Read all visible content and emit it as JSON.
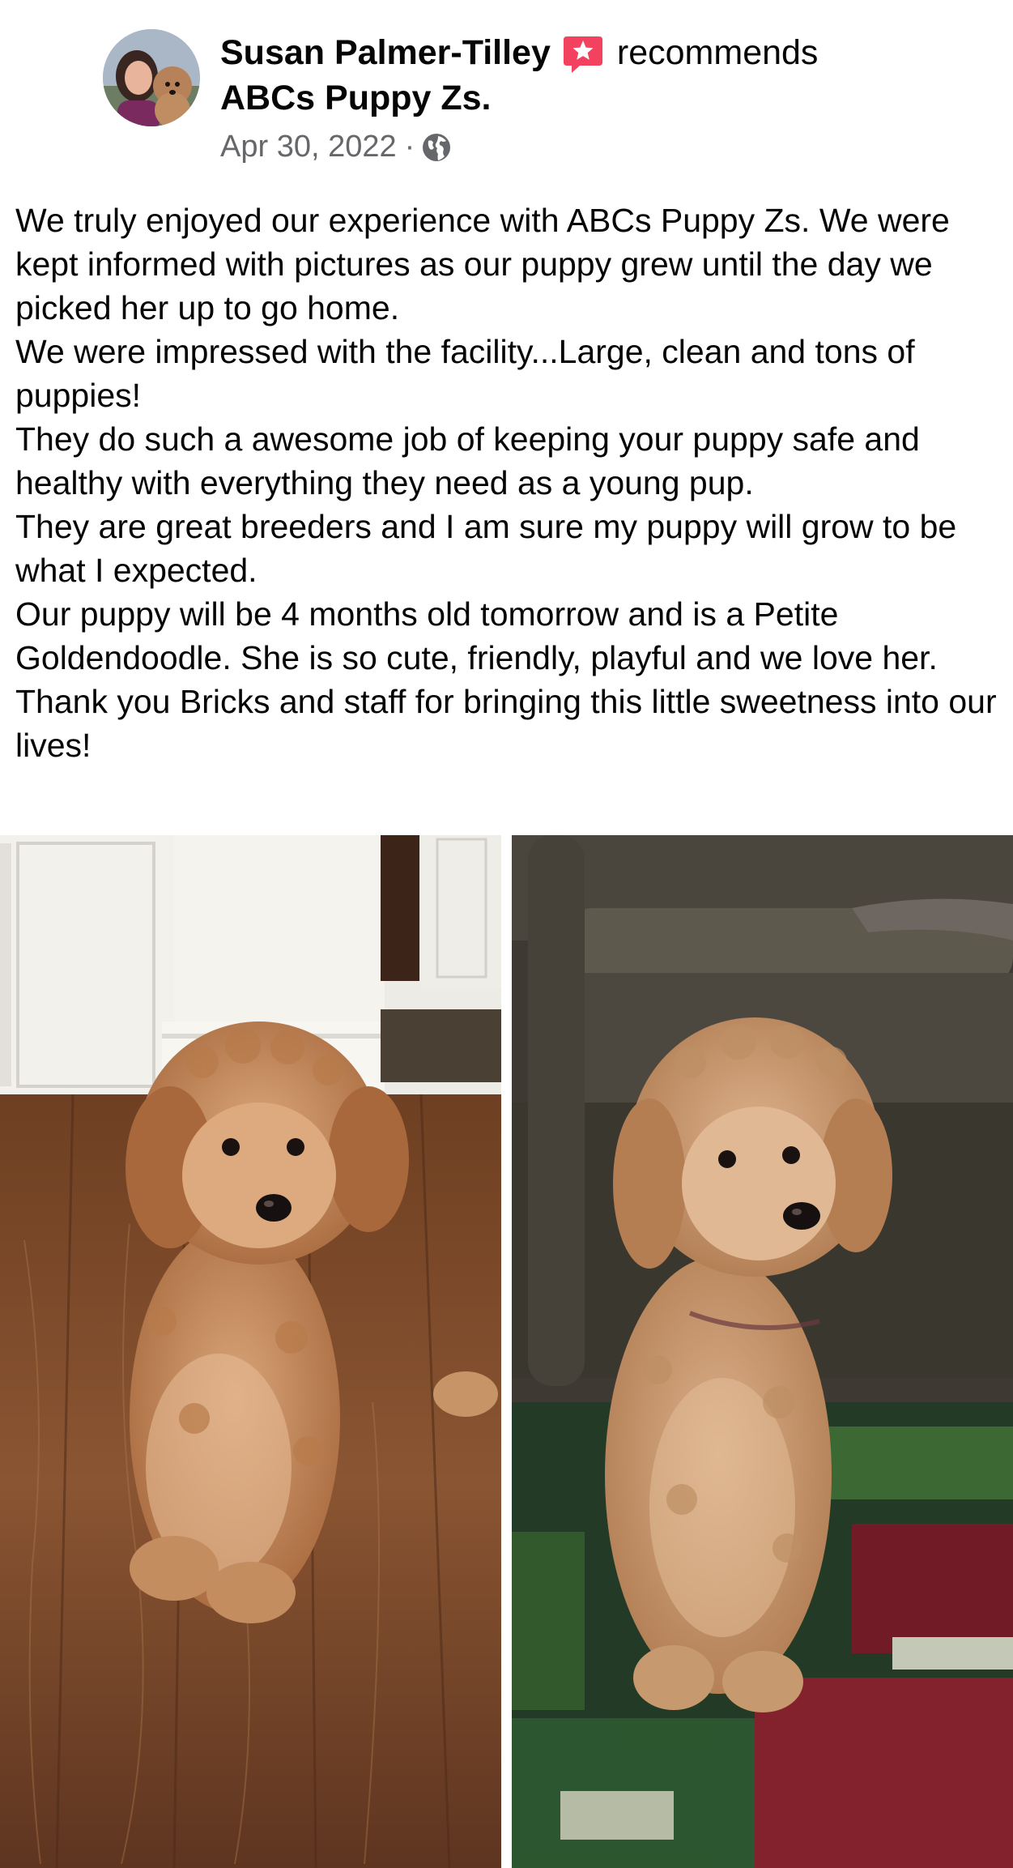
{
  "post": {
    "author_name": "Susan Palmer-Tilley",
    "recommendation_word": "recommends",
    "page_name": "ABCs Puppy Zs.",
    "date": "Apr 30, 2022",
    "separator": "·",
    "privacy_icon": "globe-icon",
    "recommend_icon": "recommendation-flag-icon",
    "paragraphs": [
      "We truly enjoyed our experience with ABCs Puppy Zs.  We were kept informed with pictures as our puppy grew until the day we picked her up to go home.",
      "We were impressed with the facility...Large, clean and tons of puppies!",
      "They do such a awesome job of keeping your puppy safe and healthy with everything they need as a young pup.",
      "They are great breeders and I am sure my puppy will grow to be what I expected.",
      "Our puppy will be 4 months old tomorrow and is a Petite Goldendoodle.  She is so cute, friendly, playful and we love her.",
      "Thank you Bricks and staff for bringing this little sweetness into our lives!"
    ]
  },
  "colors": {
    "text_primary": "#050505",
    "text_secondary": "#65676b",
    "recommend_badge": "#f3425f"
  }
}
